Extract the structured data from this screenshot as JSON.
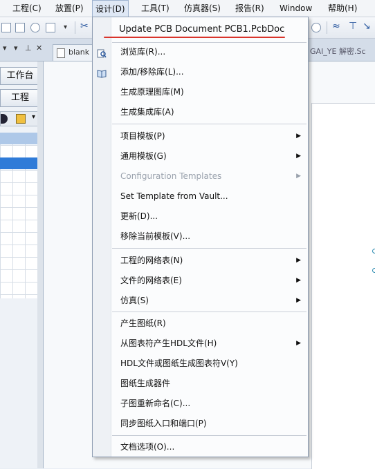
{
  "menubar": {
    "items": [
      "工程(C)",
      "放置(P)",
      "设计(D)",
      "工具(T)",
      "仿真器(S)",
      "报告(R)",
      "Window",
      "帮助(H)"
    ]
  },
  "tabs": {
    "blank_label": "blank",
    "right_label": "GAI_YE 解密.Sc"
  },
  "left_panel": {
    "btn1": "工作台",
    "btn2": "工程"
  },
  "design_menu": {
    "items": [
      {
        "label": "Update PCB Document PCB1.PcbDoc",
        "submenu": false,
        "disabled": false,
        "icon": ""
      },
      {
        "label": "浏览库(R)...",
        "submenu": false,
        "disabled": false,
        "icon": "browse-library-icon"
      },
      {
        "label": "添加/移除库(L)...",
        "submenu": false,
        "disabled": false,
        "icon": "add-remove-library-icon"
      },
      {
        "label": "生成原理图库(M)",
        "submenu": false,
        "disabled": false,
        "icon": ""
      },
      {
        "label": "生成集成库(A)",
        "submenu": false,
        "disabled": false,
        "icon": ""
      },
      {
        "label": "项目模板(P)",
        "submenu": true,
        "disabled": false,
        "icon": ""
      },
      {
        "label": "通用模板(G)",
        "submenu": true,
        "disabled": false,
        "icon": ""
      },
      {
        "label": "Configuration Templates",
        "submenu": true,
        "disabled": true,
        "icon": ""
      },
      {
        "label": "Set Template from Vault...",
        "submenu": false,
        "disabled": false,
        "icon": ""
      },
      {
        "label": "更新(D)...",
        "submenu": false,
        "disabled": false,
        "icon": ""
      },
      {
        "label": "移除当前模板(V)...",
        "submenu": false,
        "disabled": false,
        "icon": ""
      },
      {
        "label": "工程的网络表(N)",
        "submenu": true,
        "disabled": false,
        "icon": ""
      },
      {
        "label": "文件的网络表(E)",
        "submenu": true,
        "disabled": false,
        "icon": ""
      },
      {
        "label": "仿真(S)",
        "submenu": true,
        "disabled": false,
        "icon": ""
      },
      {
        "label": "产生图纸(R)",
        "submenu": false,
        "disabled": false,
        "icon": ""
      },
      {
        "label": "从图表符产生HDL文件(H)",
        "submenu": true,
        "disabled": false,
        "icon": ""
      },
      {
        "label": "HDL文件或图纸生成图表符V(Y)",
        "submenu": false,
        "disabled": false,
        "icon": ""
      },
      {
        "label": "图纸生成器件",
        "submenu": false,
        "disabled": false,
        "icon": ""
      },
      {
        "label": "子图重新命名(C)...",
        "submenu": false,
        "disabled": false,
        "icon": ""
      },
      {
        "label": "同步图纸入口和端口(P)",
        "submenu": false,
        "disabled": false,
        "icon": ""
      },
      {
        "label": "文档选项(O)...",
        "submenu": false,
        "disabled": false,
        "icon": ""
      }
    ]
  },
  "colors": {
    "highlight_underline": "#d9342b",
    "selection_blue": "#2f7bd8"
  }
}
